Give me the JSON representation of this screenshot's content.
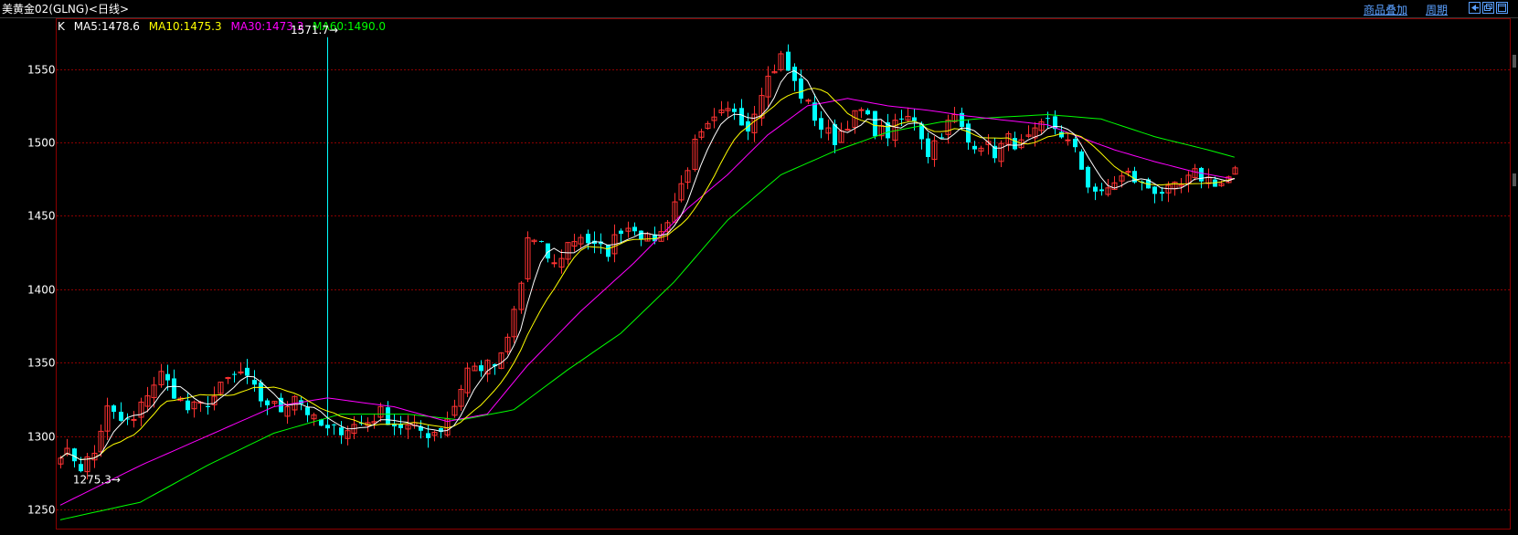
{
  "header": {
    "title": "美黄金02(GLNG)<日线>",
    "overlay_label": "商品叠加",
    "period_label": "周期"
  },
  "legend": {
    "k_label": "K",
    "ma5": "MA5:1478.6",
    "ma10": "MA10:1475.3",
    "ma30": "MA30:1473.3",
    "ma60": "MA60:1490.0"
  },
  "colors": {
    "up": "#ff3232",
    "down": "#00ffff",
    "ma5": "#ffffff",
    "ma10": "#ffff00",
    "ma30": "#ff00ff",
    "ma60": "#00ff00",
    "grid": "#8b0000",
    "axis_text": "#ffffff",
    "links": "#5aa0ff"
  },
  "chart_data": {
    "type": "candlestick",
    "title": "美黄金02(GLNG)<日线>",
    "ylim": [
      1237,
      1584
    ],
    "yticks": [
      1250,
      1300,
      1350,
      1400,
      1450,
      1500,
      1550
    ],
    "grid": true,
    "annotations": {
      "high": "1571.7→",
      "low": "1275.3→",
      "high_index": 40,
      "low_index": 3
    },
    "key_points": [
      [
        0,
        1290
      ],
      [
        2,
        1285
      ],
      [
        3,
        1279
      ],
      [
        5,
        1288
      ],
      [
        6,
        1305
      ],
      [
        7,
        1318
      ],
      [
        9,
        1310
      ],
      [
        11,
        1310
      ],
      [
        13,
        1330
      ],
      [
        15,
        1342
      ],
      [
        17,
        1330
      ],
      [
        19,
        1318
      ],
      [
        21,
        1320
      ],
      [
        23,
        1327
      ],
      [
        25,
        1338
      ],
      [
        27,
        1343
      ],
      [
        28,
        1337
      ],
      [
        30,
        1325
      ],
      [
        33,
        1318
      ],
      [
        35,
        1329
      ],
      [
        38,
        1310
      ],
      [
        40,
        1303
      ],
      [
        43,
        1306
      ],
      [
        46,
        1310
      ],
      [
        48,
        1316
      ],
      [
        50,
        1308
      ],
      [
        53,
        1305
      ],
      [
        55,
        1302
      ],
      [
        57,
        1305
      ],
      [
        59,
        1321
      ],
      [
        61,
        1346
      ],
      [
        63,
        1347
      ],
      [
        65,
        1348
      ],
      [
        66,
        1353
      ],
      [
        67,
        1366
      ],
      [
        69,
        1404
      ],
      [
        70,
        1435
      ],
      [
        72,
        1428
      ],
      [
        74,
        1416
      ],
      [
        76,
        1431
      ],
      [
        78,
        1437
      ],
      [
        80,
        1428
      ],
      [
        82,
        1426
      ],
      [
        84,
        1442
      ],
      [
        86,
        1443
      ],
      [
        88,
        1433
      ],
      [
        90,
        1438
      ],
      [
        93,
        1471
      ],
      [
        95,
        1498
      ],
      [
        97,
        1509
      ],
      [
        99,
        1518
      ],
      [
        101,
        1523
      ],
      [
        103,
        1510
      ],
      [
        105,
        1537
      ],
      [
        108,
        1558
      ],
      [
        110,
        1540
      ],
      [
        112,
        1525
      ],
      [
        114,
        1510
      ],
      [
        116,
        1502
      ],
      [
        118,
        1514
      ],
      [
        120,
        1521
      ],
      [
        122,
        1509
      ],
      [
        124,
        1506
      ],
      [
        126,
        1515
      ],
      [
        128,
        1517
      ],
      [
        130,
        1493
      ],
      [
        132,
        1508
      ],
      [
        134,
        1517
      ],
      [
        136,
        1500
      ],
      [
        138,
        1500
      ],
      [
        140,
        1493
      ],
      [
        142,
        1502
      ],
      [
        144,
        1498
      ],
      [
        146,
        1505
      ],
      [
        148,
        1514
      ],
      [
        150,
        1506
      ],
      [
        152,
        1493
      ],
      [
        154,
        1472
      ],
      [
        156,
        1463
      ],
      [
        158,
        1474
      ],
      [
        160,
        1478
      ],
      [
        162,
        1471
      ],
      [
        164,
        1468
      ],
      [
        166,
        1466
      ],
      [
        168,
        1470
      ],
      [
        170,
        1478
      ],
      [
        172,
        1475
      ],
      [
        174,
        1472
      ],
      [
        176,
        1480
      ]
    ],
    "ma60_points": [
      [
        0,
        1243
      ],
      [
        12,
        1255
      ],
      [
        22,
        1280
      ],
      [
        32,
        1302
      ],
      [
        42,
        1315
      ],
      [
        52,
        1315
      ],
      [
        60,
        1311
      ],
      [
        68,
        1318
      ],
      [
        76,
        1345
      ],
      [
        84,
        1370
      ],
      [
        92,
        1405
      ],
      [
        100,
        1447
      ],
      [
        108,
        1478
      ],
      [
        116,
        1494
      ],
      [
        124,
        1507
      ],
      [
        132,
        1514
      ],
      [
        140,
        1517
      ],
      [
        148,
        1519
      ],
      [
        156,
        1516
      ],
      [
        164,
        1504
      ],
      [
        172,
        1495
      ],
      [
        176,
        1490
      ]
    ],
    "ma30_points": [
      [
        0,
        1253
      ],
      [
        12,
        1280
      ],
      [
        22,
        1300
      ],
      [
        32,
        1320
      ],
      [
        40,
        1326
      ],
      [
        50,
        1320
      ],
      [
        58,
        1310
      ],
      [
        64,
        1315
      ],
      [
        70,
        1348
      ],
      [
        78,
        1385
      ],
      [
        86,
        1418
      ],
      [
        94,
        1455
      ],
      [
        100,
        1478
      ],
      [
        106,
        1505
      ],
      [
        112,
        1525
      ],
      [
        118,
        1530
      ],
      [
        124,
        1525
      ],
      [
        130,
        1522
      ],
      [
        136,
        1518
      ],
      [
        142,
        1515
      ],
      [
        148,
        1512
      ],
      [
        152,
        1505
      ],
      [
        158,
        1495
      ],
      [
        164,
        1487
      ],
      [
        170,
        1480
      ],
      [
        176,
        1475
      ]
    ]
  }
}
